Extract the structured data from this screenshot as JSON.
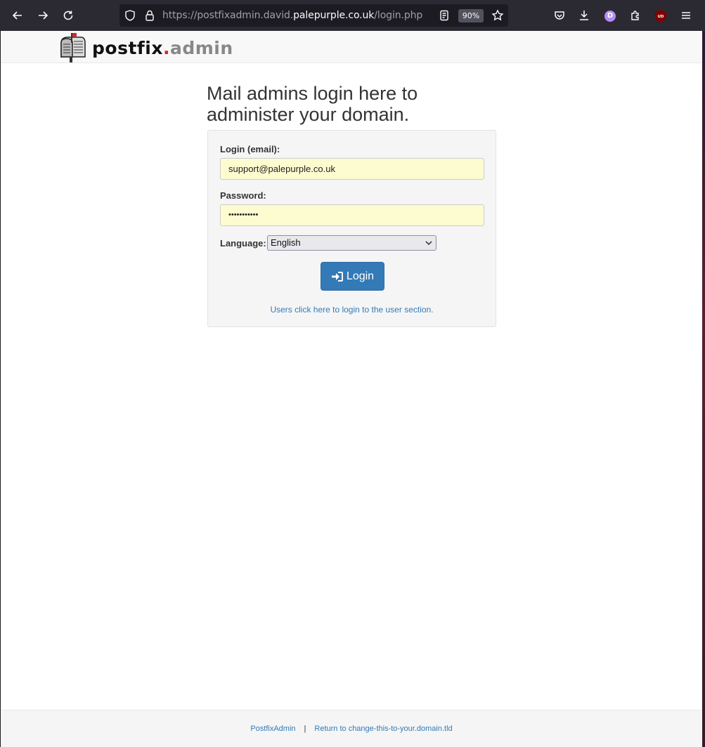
{
  "browser": {
    "url_prefix": "https://postfixadmin.david.",
    "url_host": "palepurple.co.uk",
    "url_path": "/login.php",
    "zoom": "90%",
    "profile_initial": "D",
    "ublock_label": "UD"
  },
  "logo": {
    "brand_main": "postfix",
    "brand_dot": ".",
    "brand_admin": "admin"
  },
  "page": {
    "heading": "Mail admins login here to administer your domain."
  },
  "form": {
    "login_label": "Login (email):",
    "login_value": "support@palepurple.co.uk",
    "password_label": "Password:",
    "password_mask": "•••••••••••",
    "language_label": "Language:",
    "language_value": "English",
    "login_button": "Login",
    "user_link": "Users click here to login to the user section."
  },
  "footer": {
    "app_link": "PostfixAdmin",
    "separator": "|",
    "return_link": "Return to change-this-to-your.domain.tld"
  }
}
